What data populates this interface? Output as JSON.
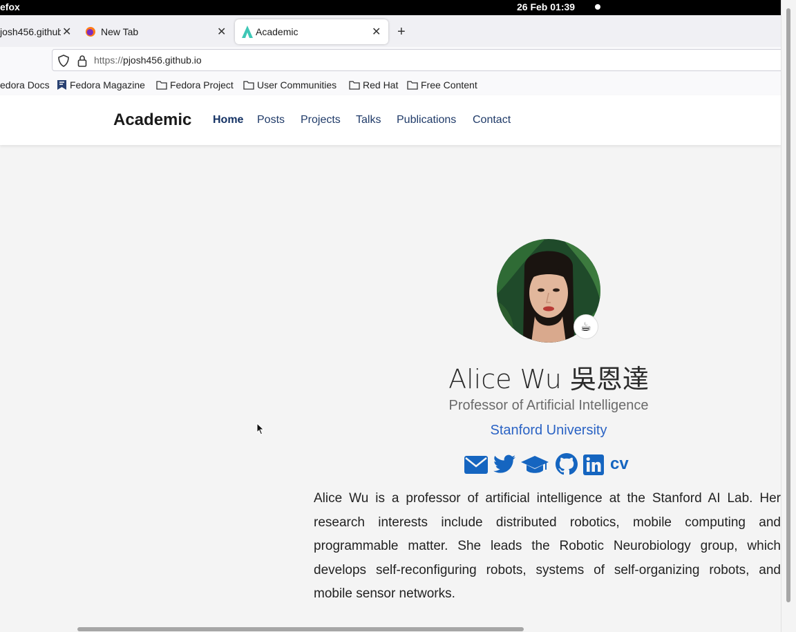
{
  "system": {
    "app_name": "efox",
    "clock": "26 Feb  01:39"
  },
  "tabs": [
    {
      "label": "josh456.github.i",
      "active": false
    },
    {
      "label": "New Tab",
      "active": false
    },
    {
      "label": "Academic",
      "active": true
    }
  ],
  "urlbar": {
    "scheme": "https://",
    "host": "pjosh456.github.io"
  },
  "bookmarks": [
    {
      "label": "edora Docs",
      "icon": "fedora-icon"
    },
    {
      "label": "Fedora Magazine",
      "icon": "fedora-magazine-icon"
    },
    {
      "label": "Fedora Project",
      "icon": "folder-icon"
    },
    {
      "label": "User Communities",
      "icon": "folder-icon"
    },
    {
      "label": "Red Hat",
      "icon": "folder-icon"
    },
    {
      "label": "Free Content",
      "icon": "folder-icon"
    }
  ],
  "site": {
    "brand": "Academic",
    "nav": [
      "Home",
      "Posts",
      "Projects",
      "Talks",
      "Publications",
      "Contact"
    ],
    "active_nav": "Home"
  },
  "profile": {
    "status_emoji": "☕",
    "name": "Alice Wu 吳恩達",
    "role": "Professor of Artificial Intelligence",
    "organization": "Stanford University",
    "social": [
      "envelope-icon",
      "twitter-icon",
      "graduation-cap-icon",
      "github-icon",
      "linkedin-icon",
      "cv"
    ],
    "cv_label": "cv",
    "bio": "Alice Wu is a professor of artificial intelligence at the Stanford AI Lab. Her research interests include distributed robotics, mobile computing and programmable matter. She leads the Robotic Neurobiology group, which develops self-reconfiguring robots, systems of self-organizing robots, and mobile sensor networks."
  },
  "colors": {
    "link_blue": "#2962c4",
    "icon_blue": "#1565c0",
    "nav_blue": "#1f3a68"
  }
}
